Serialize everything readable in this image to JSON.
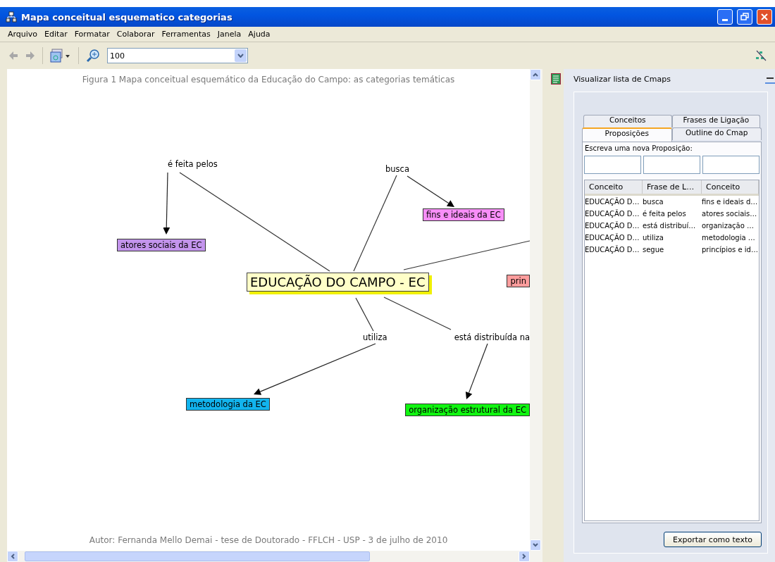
{
  "window": {
    "title": "Mapa conceitual esquematico categorias"
  },
  "menu": [
    "Arquivo",
    "Editar",
    "Formatar",
    "Colaborar",
    "Ferramentas",
    "Janela",
    "Ajuda"
  ],
  "toolbar": {
    "zoom": "100"
  },
  "canvas": {
    "caption": "Figura 1 Mapa conceitual esquemático da Educação do Campo: as categorias temáticas",
    "author": "Autor: Fernanda Mello Demai - tese de Doutorado - FFLCH - USP - 3 de julho de 2010",
    "nodes": [
      {
        "kind": "linking",
        "text": "é feita pelos"
      },
      {
        "kind": "linking",
        "text": "busca"
      },
      {
        "kind": "concept",
        "text": "fins e ideais da EC",
        "color": "#f78ef7"
      },
      {
        "kind": "concept",
        "text": "atores sociais da EC",
        "color": "#c394ec"
      },
      {
        "kind": "main",
        "text": "EDUCAÇÃO DO  CAMPO - EC",
        "color": "#ffffc8"
      },
      {
        "kind": "concept",
        "text": "prin",
        "color": "#ff9d9d"
      },
      {
        "kind": "linking",
        "text": "utiliza"
      },
      {
        "kind": "linking",
        "text": "está distribuída na"
      },
      {
        "kind": "concept",
        "text": "metodologia da EC",
        "color": "#12b4ee"
      },
      {
        "kind": "concept",
        "text": "organização estrutural da EC",
        "color": "#11f511"
      }
    ]
  },
  "panel": {
    "title": "Visualizar lista de Cmaps",
    "tabs": [
      {
        "label": "Conceitos",
        "selected": false
      },
      {
        "label": "Frases de Ligação",
        "selected": false
      },
      {
        "label": "Proposições",
        "selected": true
      },
      {
        "label": "Outline do Cmap",
        "selected": false
      }
    ],
    "prompt": "Escreva uma nova Proposição:",
    "columns": [
      "Conceito",
      "Frase de L…",
      "Conceito"
    ],
    "rows": [
      [
        "EDUCAÇÃO D…",
        "busca",
        "fins e ideais d…"
      ],
      [
        "EDUCAÇÃO D…",
        "é feita pelos",
        "atores sociais…"
      ],
      [
        "EDUCAÇÃO D…",
        "está distribuí…",
        "organização …"
      ],
      [
        "EDUCAÇÃO D…",
        "utiliza",
        "metodologia …"
      ],
      [
        "EDUCAÇÃO D…",
        "segue",
        "princípios e id…"
      ]
    ],
    "button": "Exportar como texto"
  }
}
